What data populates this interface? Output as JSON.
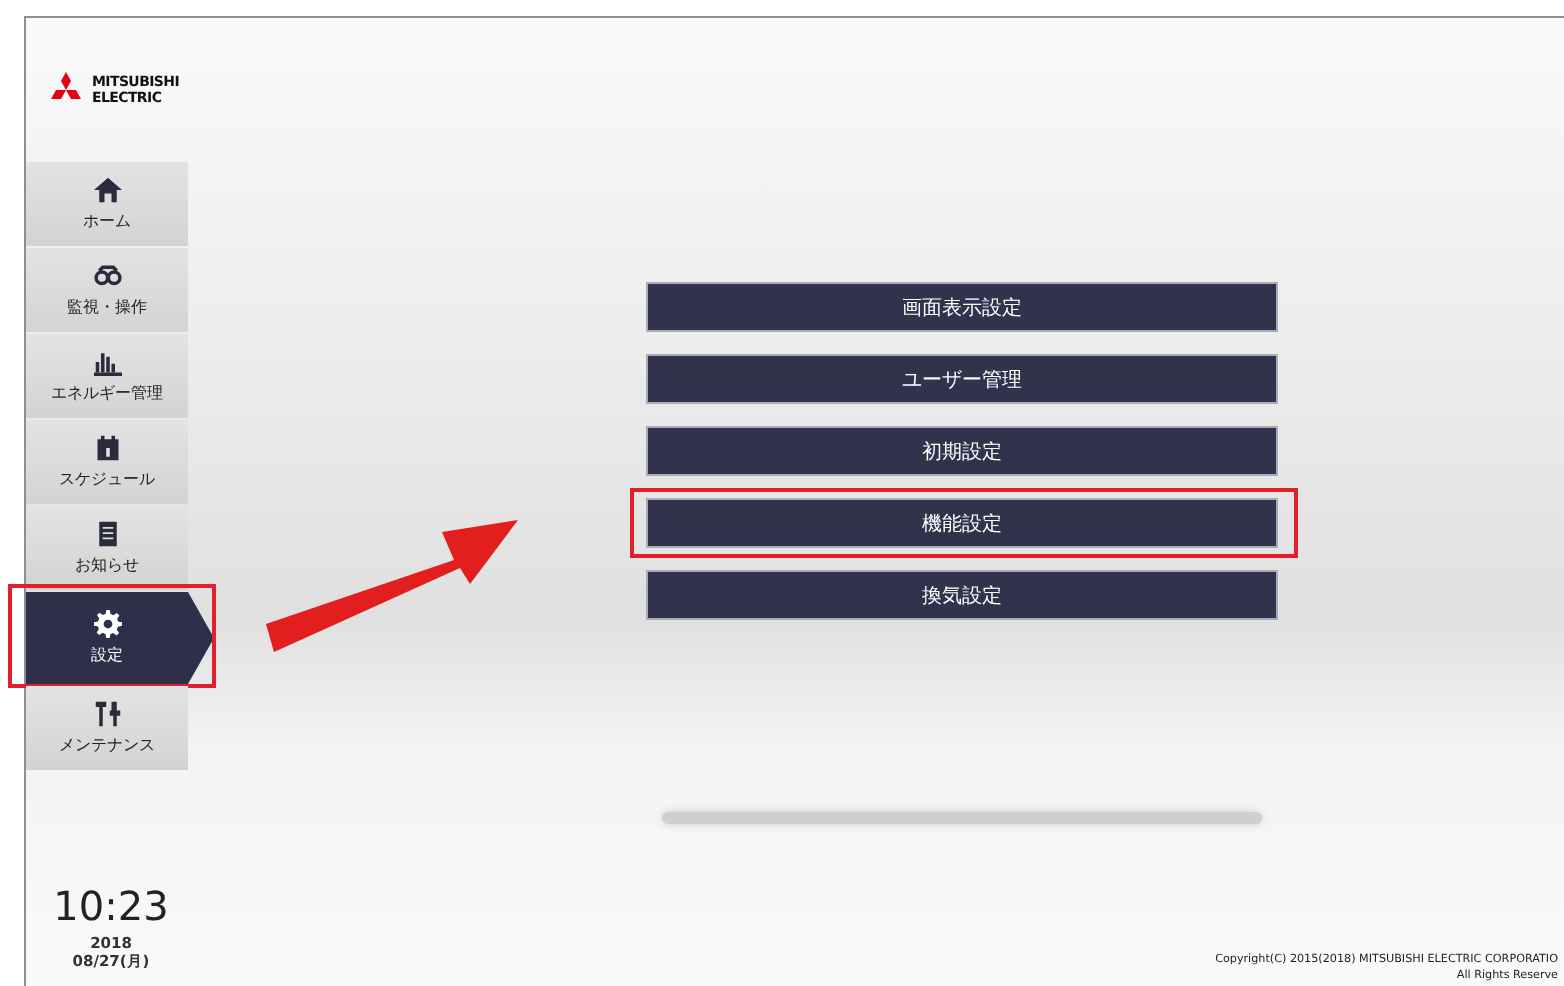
{
  "logo": {
    "line1": "MITSUBISHI",
    "line2": "ELECTRIC"
  },
  "sidebar": {
    "items": [
      {
        "kind": "home",
        "label": "ホーム",
        "selected": false,
        "highlighted": false
      },
      {
        "kind": "monitor",
        "label": "監視・操作",
        "selected": false,
        "highlighted": false
      },
      {
        "kind": "energy",
        "label": "エネルギー管理",
        "selected": false,
        "highlighted": false
      },
      {
        "kind": "schedule",
        "label": "スケジュール",
        "selected": false,
        "highlighted": false
      },
      {
        "kind": "notice",
        "label": "お知らせ",
        "selected": false,
        "highlighted": false
      },
      {
        "kind": "settings",
        "label": "設定",
        "selected": true,
        "highlighted": true
      },
      {
        "kind": "maintenance",
        "label": "メンテナンス",
        "selected": false,
        "highlighted": false
      }
    ]
  },
  "menu": [
    {
      "label": "画面表示設定",
      "highlighted": false
    },
    {
      "label": "ユーザー管理",
      "highlighted": false
    },
    {
      "label": "初期設定",
      "highlighted": false
    },
    {
      "label": "機能設定",
      "highlighted": true
    },
    {
      "label": "換気設定",
      "highlighted": false
    }
  ],
  "clock": {
    "time": "10:23",
    "year": "2018",
    "date": "08/27(月)"
  },
  "footer": {
    "copyright": "Copyright(C) 2015(2018) MITSUBISHI ELECTRIC CORPORATIO",
    "rights": "All Rights Reserve"
  }
}
